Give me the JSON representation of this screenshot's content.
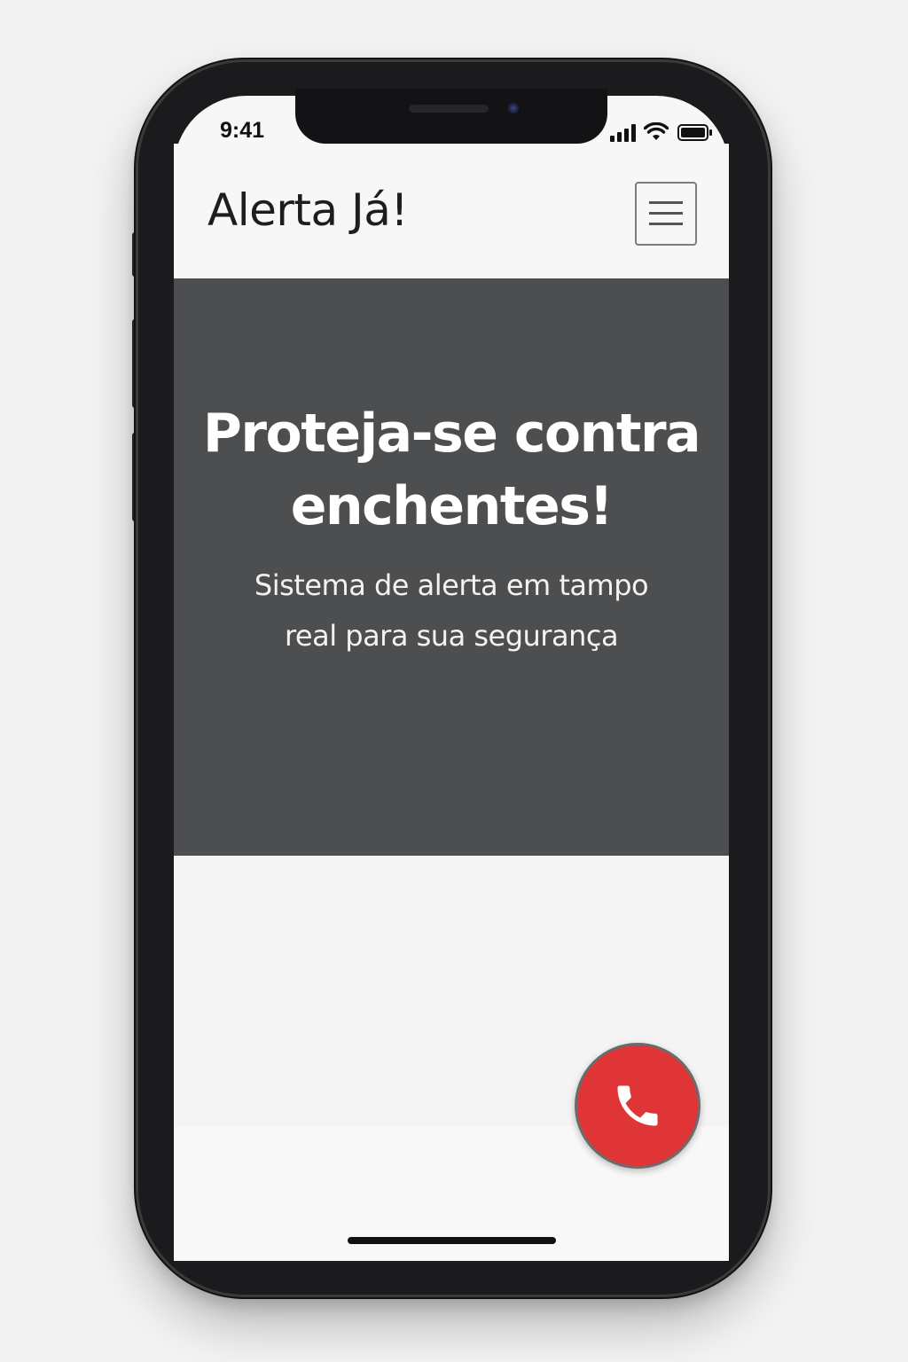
{
  "status_bar": {
    "time": "9:41",
    "icons": [
      "cellular-signal-icon",
      "wifi-icon",
      "battery-icon"
    ]
  },
  "header": {
    "title": "Alerta Já!",
    "menu_icon": "hamburger-menu-icon"
  },
  "hero": {
    "title_line1": "Proteja-se contra",
    "title_line2": "enchentes!",
    "subtitle_line1": "Sistema de alerta em tampo",
    "subtitle_line2": "real para sua segurança",
    "background_color": "#4d4e50"
  },
  "call_button": {
    "icon": "phone-icon",
    "color": "#e03536"
  }
}
